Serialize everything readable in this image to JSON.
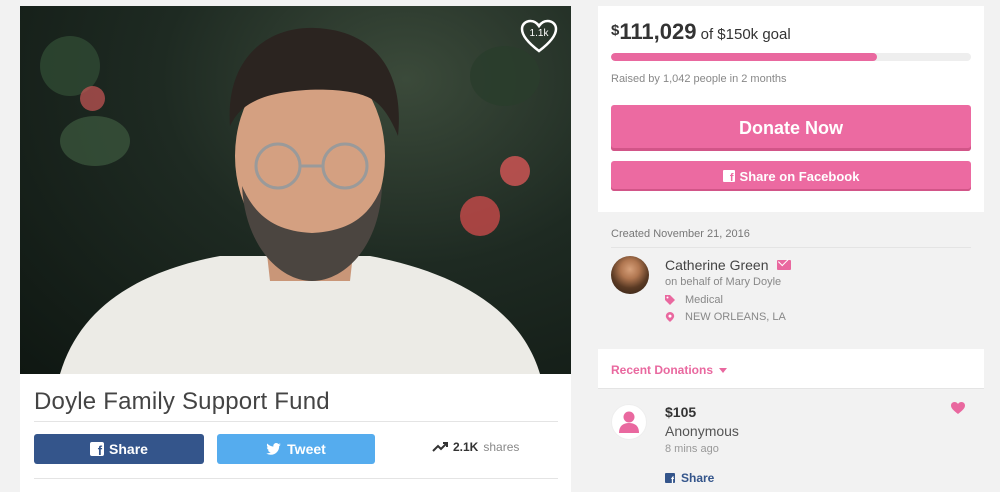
{
  "campaign": {
    "title": "Doyle Family Support Fund",
    "heart_count": "1.1k",
    "share_label": "Share",
    "tweet_label": "Tweet",
    "shares_count": "2.1K",
    "shares_label": "shares"
  },
  "donate": {
    "amount": "111,029",
    "currency": "$",
    "goal_text": "of $150k goal",
    "progress_percent": 74,
    "raised_by": "Raised by 1,042 people in 2 months",
    "donate_label": "Donate Now",
    "facebook_label": "Share on Facebook"
  },
  "created": "Created November 21, 2016",
  "organizer": {
    "name": "Catherine Green",
    "behalf": "on behalf of Mary Doyle",
    "category": "Medical",
    "location": "NEW ORLEANS, LA"
  },
  "recent": {
    "tab_label": "Recent Donations",
    "donation": {
      "amount": "$105",
      "name": "Anonymous",
      "time": "8 mins ago",
      "share_label": "Share"
    }
  },
  "colors": {
    "accent": "#ec6aa1",
    "facebook": "#34558b",
    "twitter": "#55acee"
  }
}
